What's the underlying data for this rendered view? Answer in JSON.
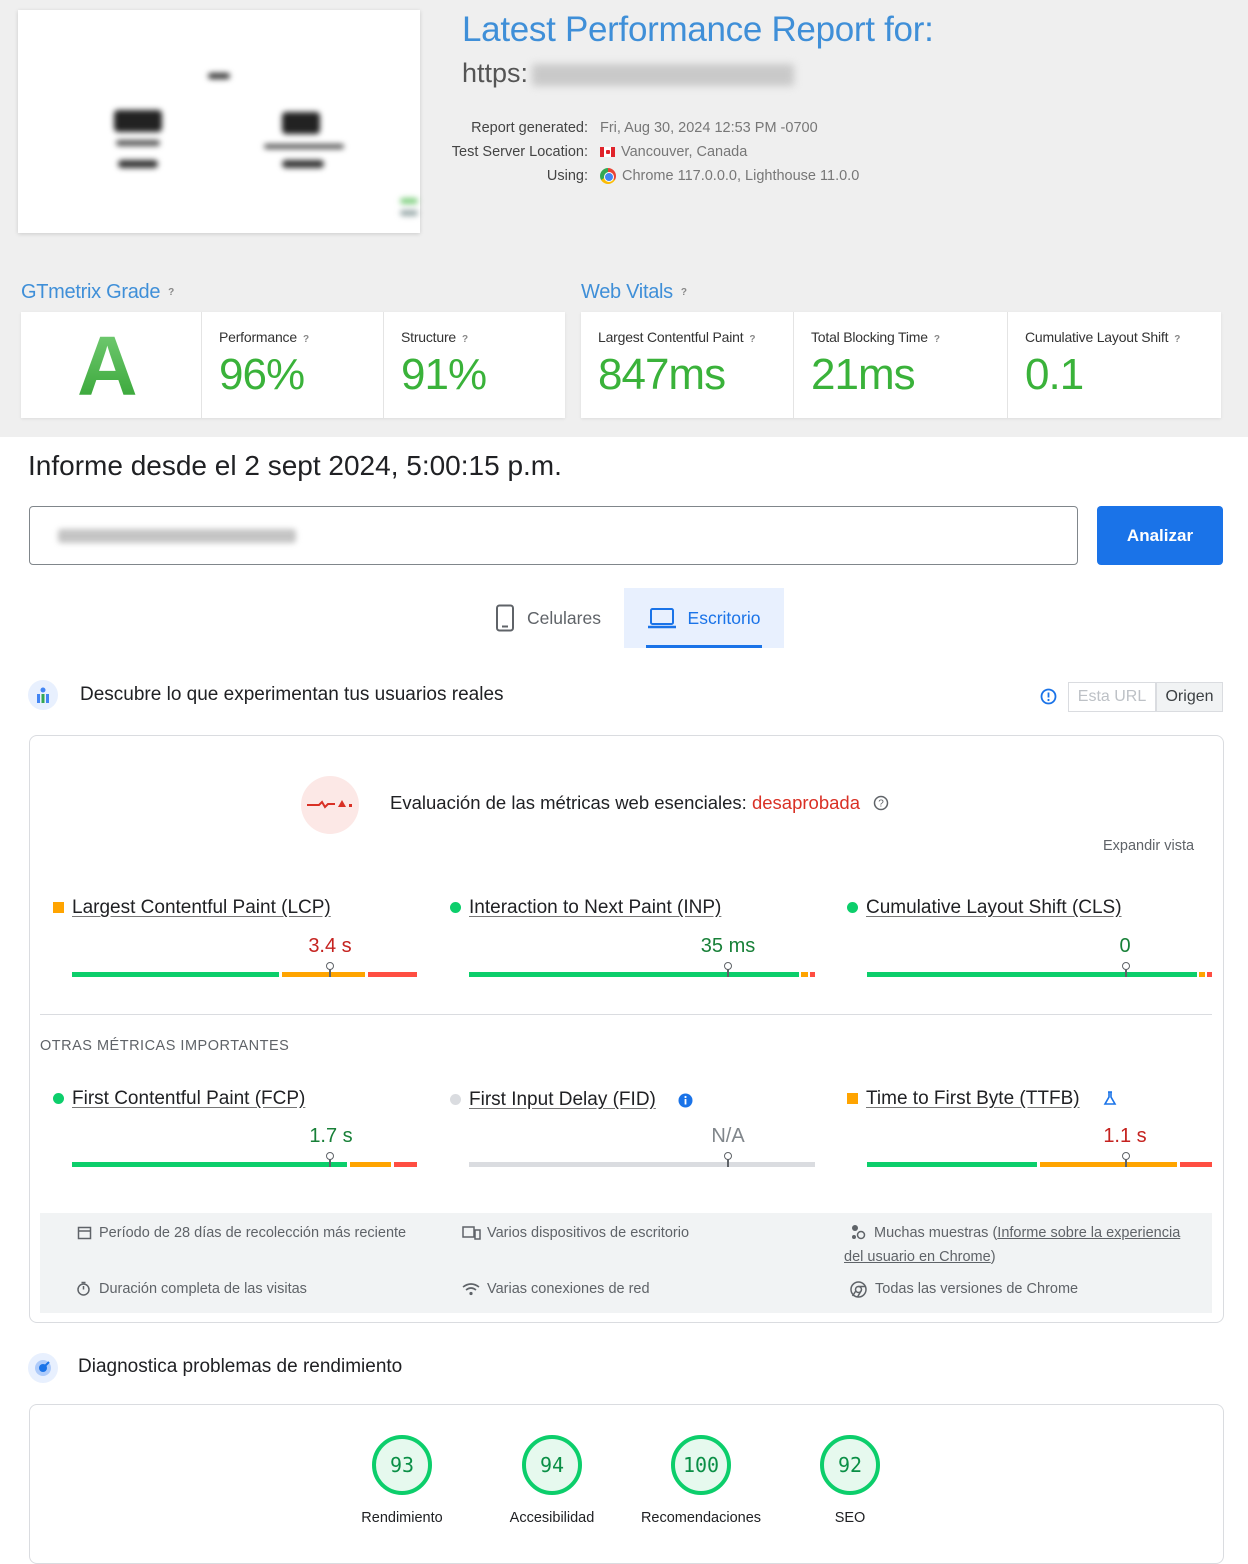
{
  "gtmetrix": {
    "title": "Latest Performance Report for:",
    "url_prefix": "https:",
    "report": {
      "generated_label": "Report generated:",
      "generated_value": "Fri, Aug 30, 2024 12:53 PM -0700",
      "location_label": "Test Server Location:",
      "location_value": "Vancouver, Canada",
      "using_label": "Using:",
      "using_value": "Chrome 117.0.0.0, Lighthouse 11.0.0"
    },
    "grade_title": "GTmetrix Grade",
    "grade": "A",
    "performance_label": "Performance",
    "performance_value": "96%",
    "structure_label": "Structure",
    "structure_value": "91%",
    "vitals_title": "Web Vitals",
    "lcp_label": "Largest Contentful Paint",
    "lcp_value": "847ms",
    "tbt_label": "Total Blocking Time",
    "tbt_value": "21ms",
    "cls_label": "Cumulative Layout Shift",
    "cls_value": "0.1",
    "help": "?"
  },
  "pagespeed": {
    "heading": "Informe desde el 2 sept 2024, 5:00:15 p.m.",
    "analyze_label": "Analizar",
    "tabs": [
      {
        "label": "Celulares",
        "icon": "phone-icon",
        "active": false
      },
      {
        "label": "Escritorio",
        "icon": "laptop-icon",
        "active": true
      }
    ],
    "field": {
      "heading": "Descubre lo que experimentan tus usuarios reales",
      "toggle_url": "Esta URL",
      "toggle_origin": "Origen",
      "assessment_prefix": "Evaluación de las métricas web esenciales: ",
      "assessment_result": "desaprobada",
      "expand": "Expandir vista",
      "core": [
        {
          "label": "Largest Contentful Paint (LCP)",
          "value": "3.4 s",
          "status": "needs-improvement",
          "color": "#c5221f"
        },
        {
          "label": "Interaction to Next Paint (INP)",
          "value": "35 ms",
          "status": "good",
          "color": "#188038"
        },
        {
          "label": "Cumulative Layout Shift (CLS)",
          "value": "0",
          "status": "good",
          "color": "#188038"
        }
      ],
      "other_heading": "OTRAS MÉTRICAS IMPORTANTES",
      "other": [
        {
          "label": "First Contentful Paint (FCP)",
          "value": "1.7 s",
          "status": "good"
        },
        {
          "label": "First Input Delay (FID)",
          "value": "N/A",
          "status": "none"
        },
        {
          "label": "Time to First Byte (TTFB)",
          "value": "1.1 s",
          "status": "needs-improvement"
        }
      ],
      "info": {
        "period": "Período de 28 días de recolección más reciente",
        "devices": "Varios dispositivos de escritorio",
        "samples_prefix": "Muchas muestras (",
        "samples_link": "Informe sobre la experiencia del usuario en Chrome",
        "samples_suffix": ")",
        "duration": "Duración completa de las visitas",
        "network": "Varias conexiones de red",
        "versions": "Todas las versiones de Chrome"
      }
    },
    "diagnose": {
      "heading": "Diagnostica problemas de rendimiento",
      "scores": [
        {
          "value": "93",
          "label": "Rendimiento"
        },
        {
          "value": "94",
          "label": "Accesibilidad"
        },
        {
          "value": "100",
          "label": "Recomendaciones"
        },
        {
          "value": "92",
          "label": "SEO"
        }
      ]
    },
    "colors": {
      "good": "#0cce6b",
      "average": "#ffa400",
      "poor": "#ff4e42",
      "accent": "#1a73e8"
    }
  }
}
